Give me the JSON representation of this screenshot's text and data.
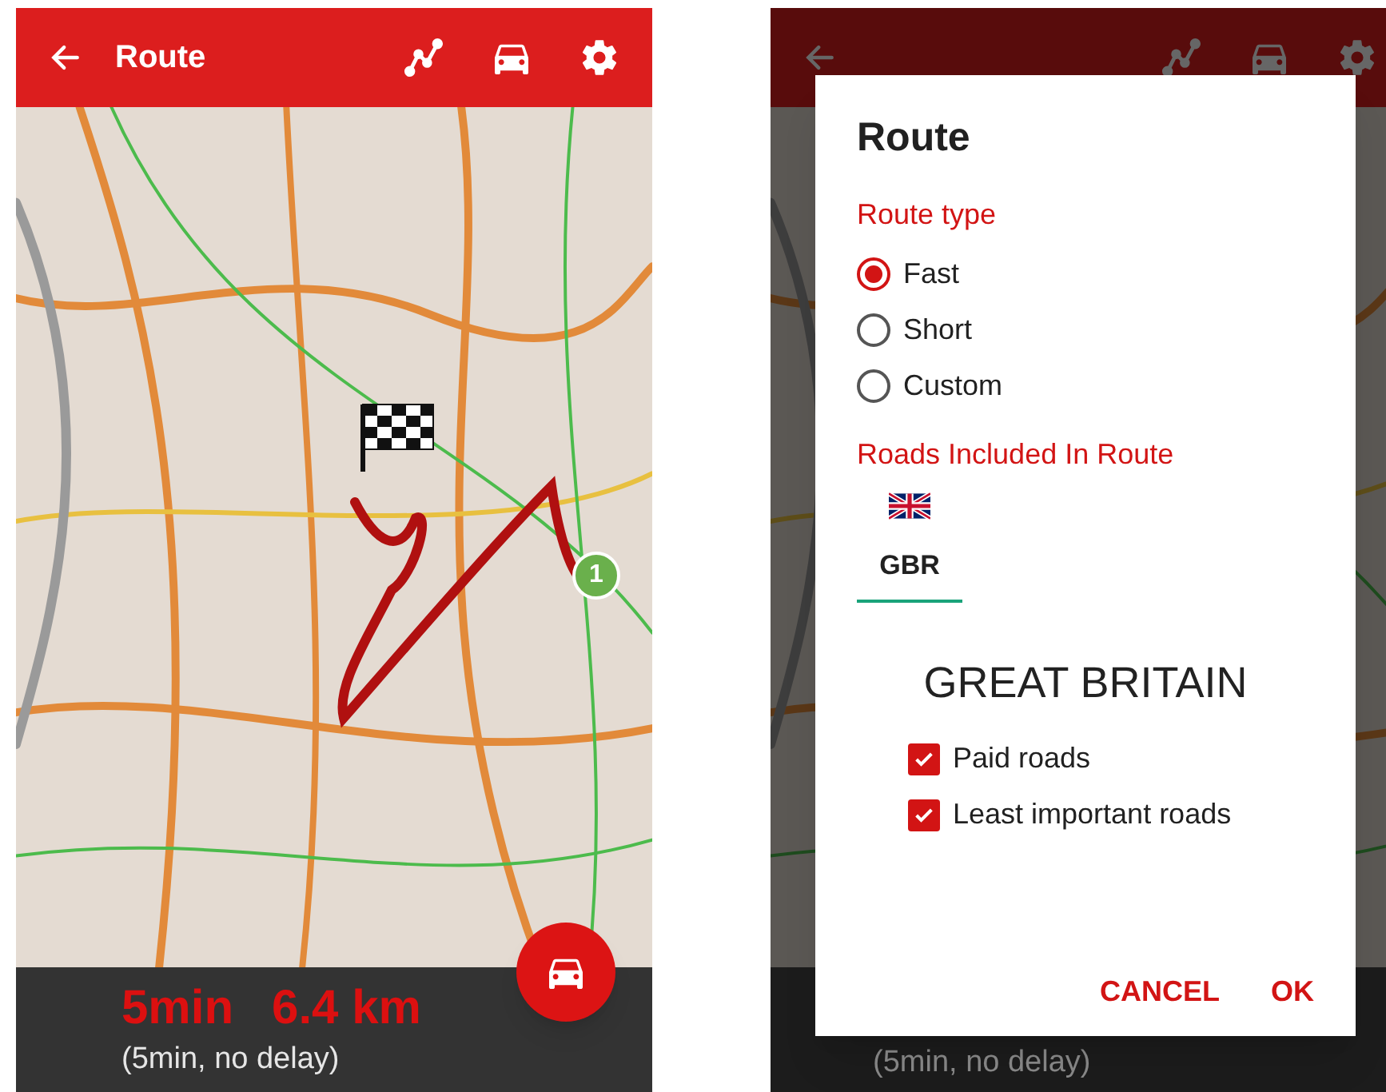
{
  "left": {
    "toolbar": {
      "title": "Route"
    },
    "map": {
      "waypoint": "1"
    },
    "summary": {
      "time": "5min",
      "distance": "6.4 km",
      "detail": "(5min, no delay)"
    }
  },
  "right": {
    "background": {
      "detail": "(5min, no delay)"
    },
    "dialog": {
      "title": "Route",
      "route_type": {
        "label": "Route type",
        "options": [
          {
            "label": "Fast",
            "selected": true
          },
          {
            "label": "Short",
            "selected": false
          },
          {
            "label": "Custom",
            "selected": false
          }
        ]
      },
      "roads": {
        "label": "Roads Included In Route",
        "tabs": [
          {
            "label": "GBR",
            "selected": true
          }
        ],
        "country": "GREAT BRITAIN",
        "options": [
          {
            "label": "Paid roads",
            "checked": true
          },
          {
            "label": "Least important roads",
            "checked": true
          }
        ]
      },
      "buttons": [
        "CANCEL",
        "OK"
      ]
    }
  }
}
